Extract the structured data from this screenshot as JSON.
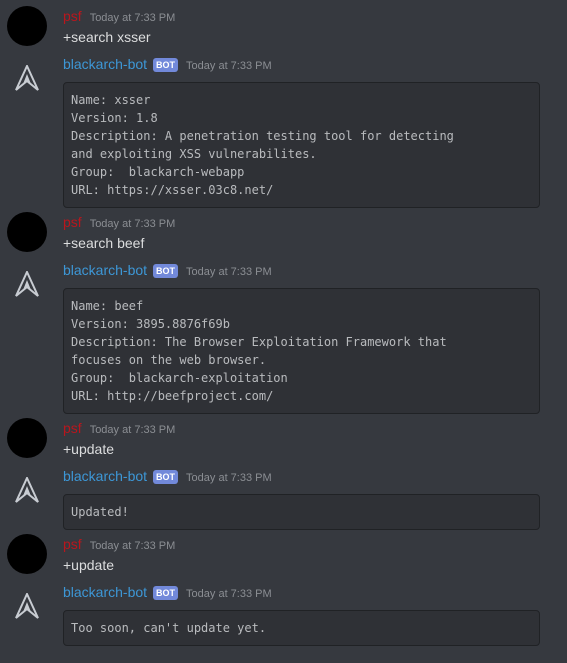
{
  "colors": {
    "background": "#36393f",
    "user_name": "#b9161d",
    "bot_name": "#3d97d6",
    "bot_tag": "#7289da",
    "code_bg": "#2f3136"
  },
  "messages": [
    {
      "author": "psf",
      "time": "Today at 7:33 PM",
      "text": "+search xsser"
    },
    {
      "author": "blackarch-bot",
      "tag": "BOT",
      "time": "Today at 7:33 PM",
      "code": [
        "Name: xsser",
        "Version: 1.8",
        "Description: A penetration testing tool for detecting",
        "and exploiting XSS vulnerabilites.",
        "Group:  blackarch-webapp",
        "URL: https://xsser.03c8.net/"
      ]
    },
    {
      "author": "psf",
      "time": "Today at 7:33 PM",
      "text": "+search beef"
    },
    {
      "author": "blackarch-bot",
      "tag": "BOT",
      "time": "Today at 7:33 PM",
      "code": [
        "Name: beef",
        "Version: 3895.8876f69b",
        "Description: The Browser Exploitation Framework that",
        "focuses on the web browser.",
        "Group:  blackarch-exploitation",
        "URL: http://beefproject.com/"
      ]
    },
    {
      "author": "psf",
      "time": "Today at 7:33 PM",
      "text": "+update"
    },
    {
      "author": "blackarch-bot",
      "tag": "BOT",
      "time": "Today at 7:33 PM",
      "code": [
        "Updated!"
      ]
    },
    {
      "author": "psf",
      "time": "Today at 7:33 PM",
      "text": "+update"
    },
    {
      "author": "blackarch-bot",
      "tag": "BOT",
      "time": "Today at 7:33 PM",
      "code": [
        "Too soon, can't update yet."
      ]
    }
  ]
}
